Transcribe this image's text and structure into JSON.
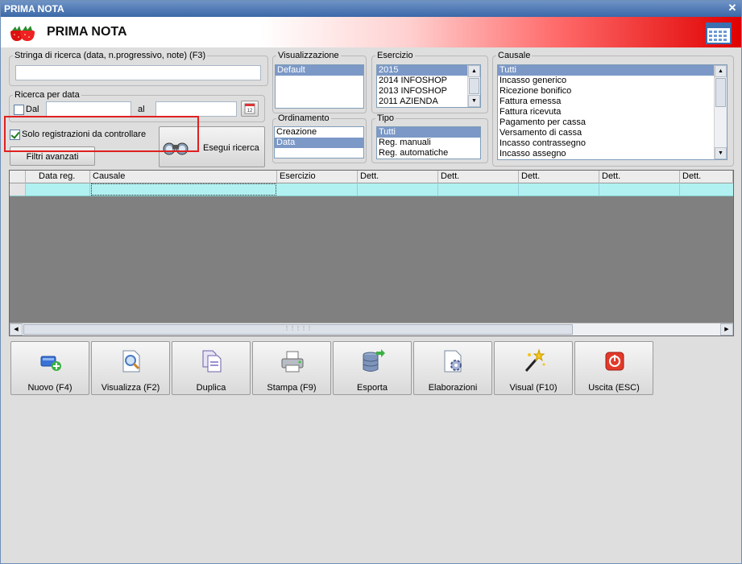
{
  "window": {
    "title": "PRIMA NOTA"
  },
  "header": {
    "title": "PRIMA NOTA"
  },
  "search": {
    "legend": "Stringa di ricerca (data, n.progressivo, note) (F3)",
    "value": ""
  },
  "date_search": {
    "legend": "Ricerca per data",
    "from_label": "Dal",
    "to_label": "al",
    "from_value": "",
    "to_value": "",
    "from_checked": false
  },
  "options": {
    "only_to_check_label": "Solo registrazioni da controllare",
    "only_to_check_checked": true
  },
  "buttons": {
    "advanced_filters": "Filtri avanzati",
    "run_search": "Esegui ricerca"
  },
  "visualizzazione": {
    "legend": "Visualizzazione",
    "items": [
      "Default"
    ],
    "selected": 0
  },
  "esercizio": {
    "legend": "Esercizio",
    "items": [
      "2015",
      "2014 INFOSHOP",
      "2013 INFOSHOP",
      "2011 AZIENDA"
    ],
    "selected": 0
  },
  "ordinamento": {
    "legend": "Ordinamento",
    "items": [
      "Creazione",
      "Data"
    ],
    "selected": 1
  },
  "tipo": {
    "legend": "Tipo",
    "items": [
      "Tutti",
      "Reg. manuali",
      "Reg. automatiche"
    ],
    "selected": 0
  },
  "causale": {
    "legend": "Causale",
    "items": [
      "Tutti",
      "Incasso generico",
      "Ricezione bonifico",
      "Fattura emessa",
      "Fattura ricevuta",
      "Pagamento per cassa",
      "Versamento di cassa",
      "Incasso contrassegno",
      "Incasso assegno"
    ],
    "selected": 0
  },
  "grid": {
    "columns": [
      "Data reg.",
      "Causale",
      "Esercizio",
      "Dett.",
      "Dett.",
      "Dett.",
      "Dett.",
      "Dett."
    ]
  },
  "toolbar": {
    "items": [
      {
        "label": "Nuovo (F4)",
        "icon": "new-icon"
      },
      {
        "label": "Visualizza (F2)",
        "icon": "view-icon"
      },
      {
        "label": "Duplica",
        "icon": "duplicate-icon"
      },
      {
        "label": "Stampa (F9)",
        "icon": "print-icon"
      },
      {
        "label": "Esporta",
        "icon": "export-icon"
      },
      {
        "label": "Elaborazioni",
        "icon": "process-icon"
      },
      {
        "label": "Visual (F10)",
        "icon": "wand-icon"
      },
      {
        "label": "Uscita (ESC)",
        "icon": "exit-icon"
      }
    ]
  },
  "colors": {
    "accent": "#7b98c6",
    "row_highlight": "#b2f1f1",
    "header_red": "#e00000",
    "annotation": "#e02020"
  }
}
